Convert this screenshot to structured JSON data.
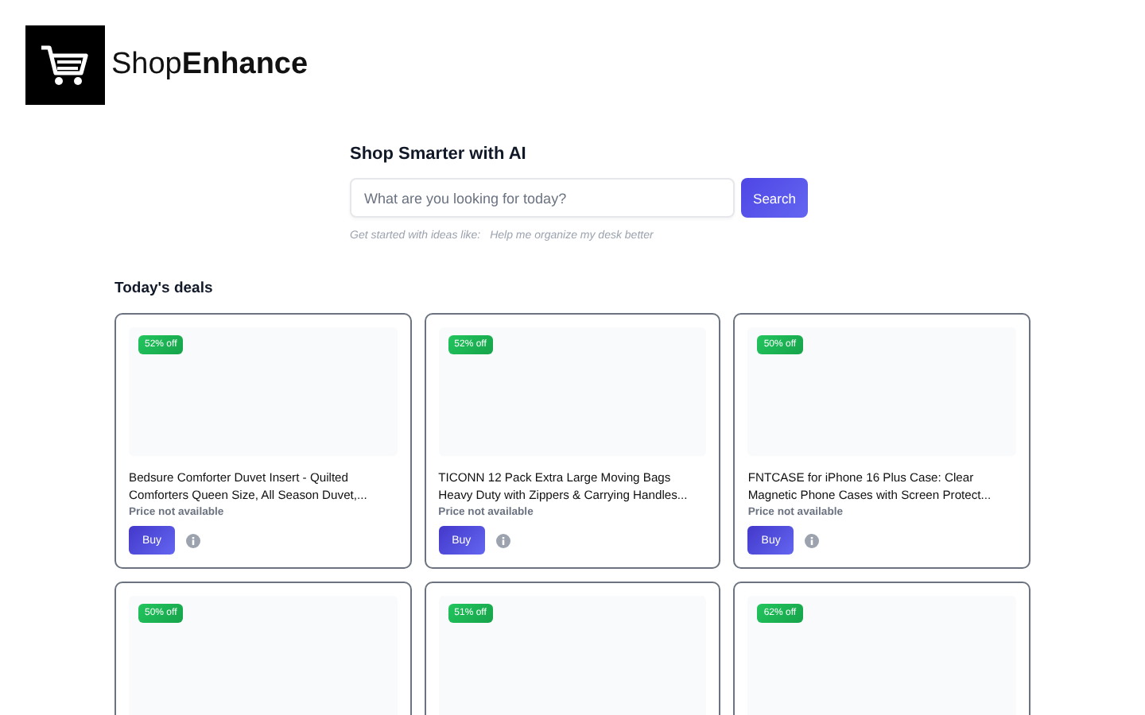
{
  "brand": {
    "name": "Shop**Enhance**"
  },
  "search": {
    "heading": "Shop Smarter with AI",
    "placeholder": "What are you looking for today?",
    "button": "Search",
    "hint_label": "Get started with ideas like:",
    "hint_example": "Help me organize my desk better"
  },
  "deals": {
    "heading": "Today's deals",
    "items": [
      {
        "badge": "52% off",
        "title": "Bedsure Comforter Duvet Insert - Quilted Comforters Queen Size, All Season Duvet,...",
        "price": "Price not available",
        "button": "Buy"
      },
      {
        "badge": "52% off",
        "title": "TICONN 12 Pack Extra Large Moving Bags Heavy Duty with Zippers & Carrying Handles...",
        "price": "Price not available",
        "button": "Buy"
      },
      {
        "badge": "50% off",
        "title": "FNTCASE for iPhone 16 Plus Case: Clear Magnetic Phone Cases with Screen Protect...",
        "price": "Price not available",
        "button": "Buy"
      },
      {
        "badge": "50% off"
      },
      {
        "badge": "51% off"
      },
      {
        "badge": "62% off"
      }
    ]
  }
}
